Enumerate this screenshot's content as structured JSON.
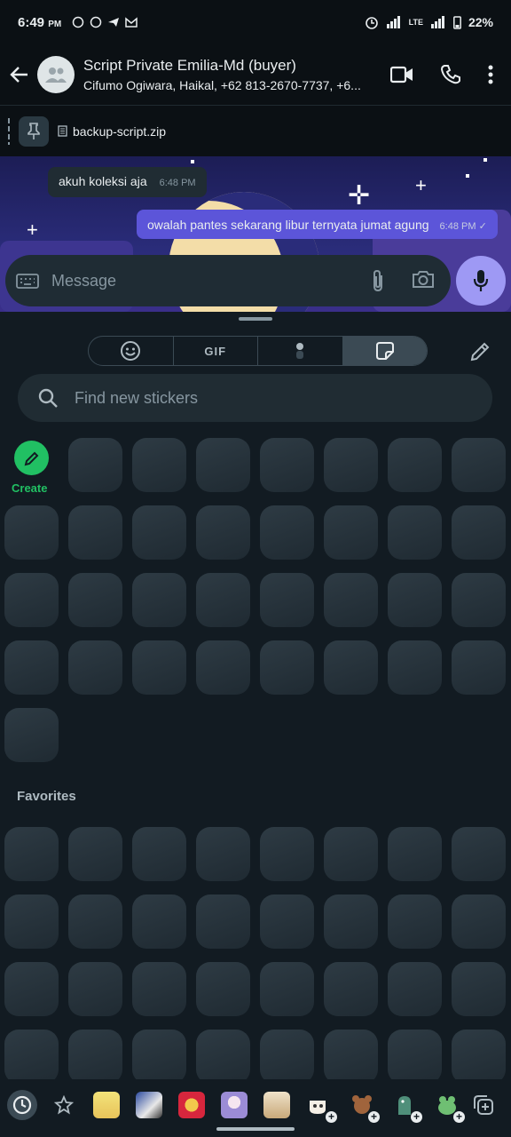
{
  "status_bar": {
    "time": "6:49",
    "ampm": "PM",
    "network": "LTE",
    "battery": "22%"
  },
  "header": {
    "title": "Script Private Emilia-Md (buyer)",
    "subtitle": "Cifumo Ogiwara, Haikal, +62 813-2670-7737, +6..."
  },
  "pinned": {
    "file_name": "backup-script.zip"
  },
  "messages": [
    {
      "direction": "in",
      "text": "akuh koleksi aja",
      "time": "6:48 PM"
    },
    {
      "direction": "out",
      "text": "owalah pantes sekarang libur ternyata jumat agung",
      "time": "6:48 PM",
      "status": "sent"
    }
  ],
  "composer": {
    "placeholder": "Message"
  },
  "panel": {
    "tabs": [
      {
        "label": "",
        "icon": "emoji-icon"
      },
      {
        "label": "GIF",
        "icon": ""
      },
      {
        "label": "",
        "icon": "avatar-icon"
      },
      {
        "label": "",
        "icon": "sticker-icon",
        "selected": true
      }
    ],
    "search_placeholder": "Find new stickers",
    "create_label": "Create",
    "favorites_label": "Favorites"
  },
  "colors": {
    "accent_green": "#21c063",
    "bubble_out": "#5c55d9",
    "mic_button": "#9e99f4",
    "background": "#121b22"
  }
}
